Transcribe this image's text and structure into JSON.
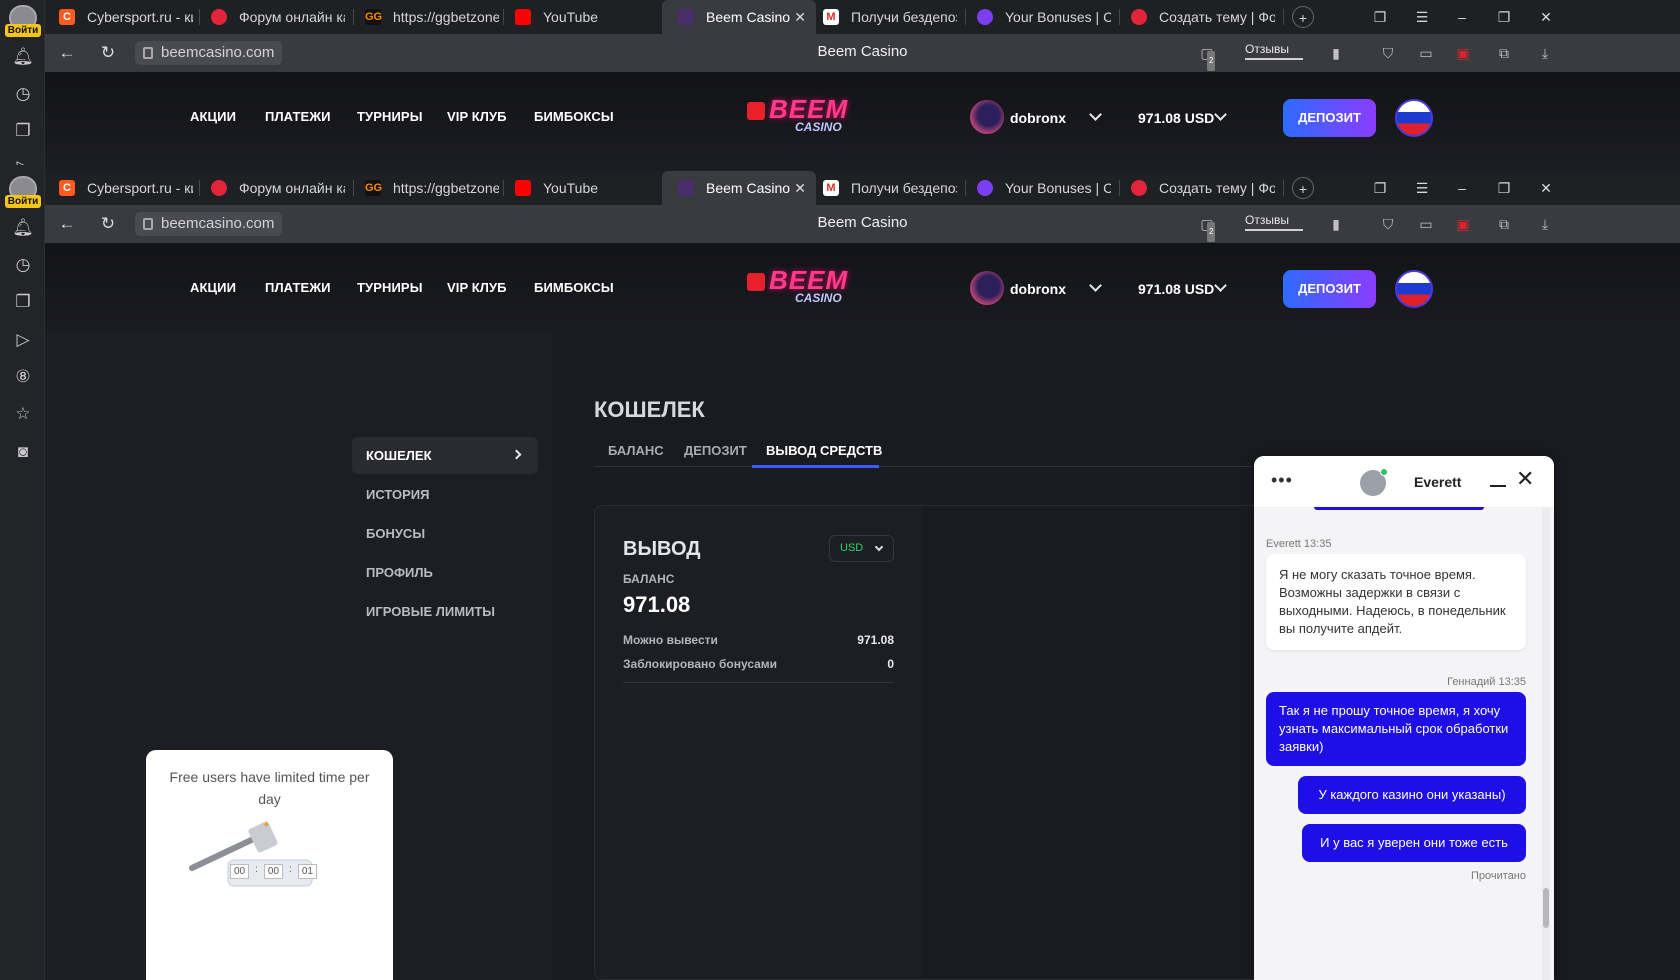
{
  "browser": {
    "login_badge": "Войти",
    "tabs": [
      {
        "label": "Cybersport.ru - кибе",
        "fav": "C"
      },
      {
        "label": "Форум онлайн кази",
        "fav": ""
      },
      {
        "label": "https://ggbetzone.co",
        "fav": "GG"
      },
      {
        "label": "YouTube",
        "fav": ""
      },
      {
        "label": "Beem Casino",
        "fav": ""
      },
      {
        "label": "Получи бездепозит",
        "fav": "M"
      },
      {
        "label": "Your Bonuses | Cadal",
        "fav": ""
      },
      {
        "label": "Создать тему | Фору",
        "fav": ""
      }
    ],
    "url": "beemcasino.com",
    "page_title": "Beem Casino",
    "reviews_label": "Отзывы",
    "tab_count_badge": "2"
  },
  "site": {
    "nav": [
      "АКЦИИ",
      "ПЛАТЕЖИ",
      "ТУРНИРЫ",
      "VIP КЛУБ",
      "БИМБОКСЫ"
    ],
    "logo_main": "BEEM",
    "logo_sub": "CASINO",
    "username": "dobronx",
    "balance": "971.08 USD",
    "deposit_button": "ДЕПОЗИТ"
  },
  "sidebar": {
    "items": [
      "КОШЕЛЕК",
      "ИСТОРИЯ",
      "БОНУСЫ",
      "ПРОФИЛЬ",
      "ИГРОВЫЕ ЛИМИТЫ"
    ]
  },
  "wallet": {
    "title": "КОШЕЛЕК",
    "tabs": [
      "БАЛАНС",
      "ДЕПОЗИТ",
      "ВЫВОД СРЕДСТВ"
    ],
    "withdraw_title": "ВЫВОД",
    "currency": "USD",
    "balance_label": "БАЛАНС",
    "balance_value": "971.08",
    "can_withdraw_label": "Можно вывести",
    "can_withdraw_value": "971.08",
    "blocked_label": "Заблокировано бонусами",
    "blocked_value": "0"
  },
  "promo": {
    "text": "Free users have limited time per day",
    "timer": [
      "00",
      "00",
      "01"
    ]
  },
  "chat": {
    "agent_name": "Everett",
    "msg1_meta": "Everett 13:35",
    "msg1_text": "Я не могу сказать точное время. Возможны задержки в связи с выходными. Надеюсь, в понедельник вы получите апдейт.",
    "msg2_meta": "Геннадий 13:35",
    "msg2_text": "Так я не прошу точное время, я хочу узнать максимальный срок обработки заявки)",
    "msg3_text": "У каждого казино они указаны)",
    "msg4_text": "И у вас я уверен они тоже есть",
    "read_status": "Прочитано"
  }
}
